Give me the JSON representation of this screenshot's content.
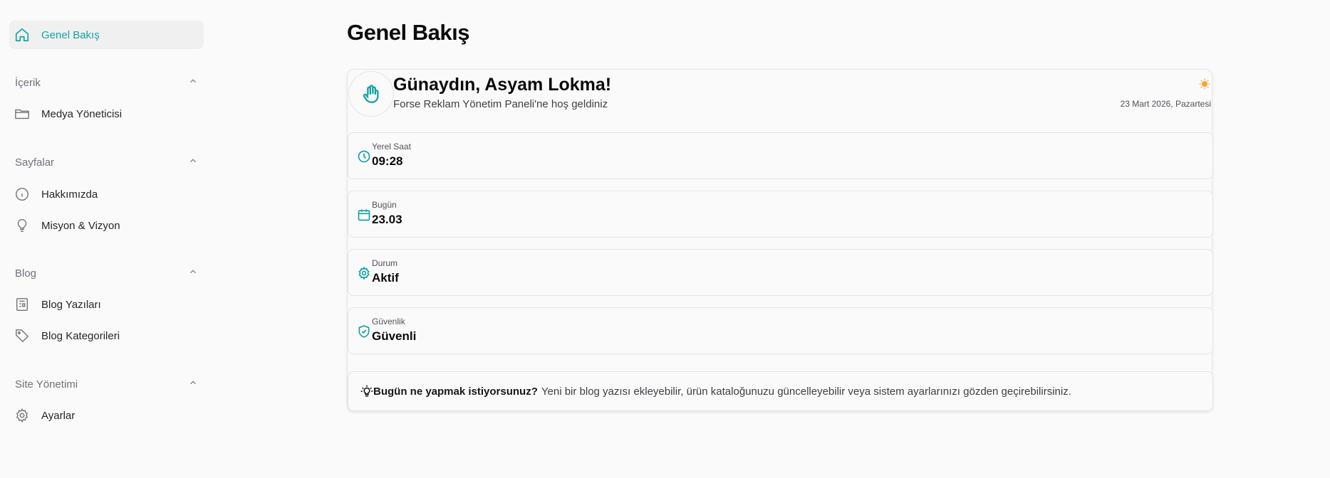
{
  "sidebar": {
    "home": {
      "label": "Genel Bakış",
      "icon": "home-icon"
    },
    "groups": [
      {
        "title": "İçerik",
        "items": [
          {
            "label": "Medya Yöneticisi",
            "icon": "folder-icon"
          }
        ]
      },
      {
        "title": "Sayfalar",
        "items": [
          {
            "label": "Hakkımızda",
            "icon": "info-icon"
          },
          {
            "label": "Misyon & Vizyon",
            "icon": "lightbulb-icon"
          }
        ]
      },
      {
        "title": "Blog",
        "items": [
          {
            "label": "Blog Yazıları",
            "icon": "newspaper-icon"
          },
          {
            "label": "Blog Kategorileri",
            "icon": "tag-icon"
          }
        ]
      },
      {
        "title": "Site Yönetimi",
        "items": [
          {
            "label": "Ayarlar",
            "icon": "gear-icon"
          }
        ]
      }
    ]
  },
  "main": {
    "title": "Genel Bakış",
    "welcome": {
      "greeting": "Günaydın, Asyam Lokma!",
      "subtitle": "Forse Reklam Yönetim Paneli'ne hoş geldiniz",
      "date": "23 Mart 2026, Pazartesi"
    },
    "stats": [
      {
        "label": "Yerel Saat",
        "value": "09:28",
        "icon": "clock-icon"
      },
      {
        "label": "Bugün",
        "value": "23.03",
        "icon": "calendar-icon"
      },
      {
        "label": "Durum",
        "value": "Aktif",
        "icon": "gear-icon"
      },
      {
        "label": "Güvenlik",
        "value": "Güvenli",
        "icon": "shield-check-icon"
      }
    ],
    "tip": {
      "bold": "Bugün ne yapmak istiyorsunuz?",
      "text": "Yeni bir blog yazısı ekleyebilir, ürün kataloğunuzu güncelleyebilir veya sistem ayarlarınızı gözden geçirebilirsiniz."
    }
  },
  "colors": {
    "accent": "#14a3a3",
    "sun": "#f5a623"
  }
}
